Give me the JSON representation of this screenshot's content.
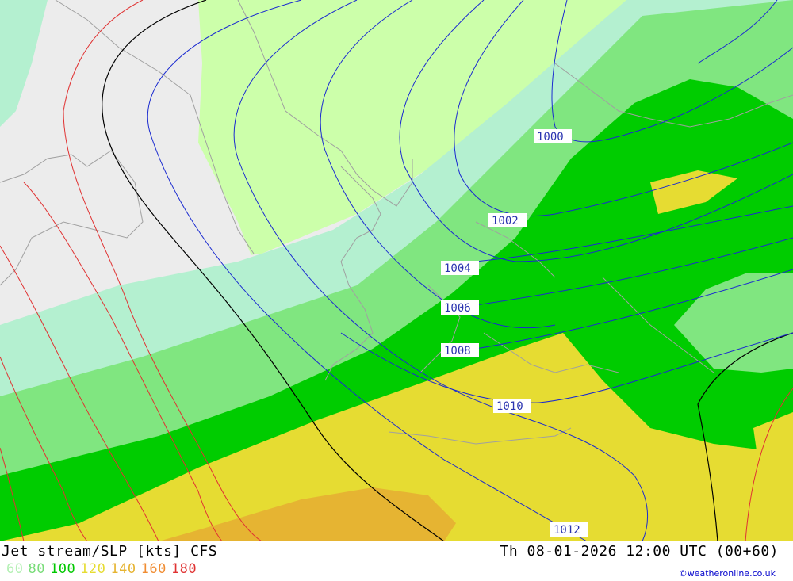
{
  "header": {
    "title_left": "Jet stream/SLP [kts] CFS",
    "title_right": "Th 08-01-2026 12:00 UTC (00+60)"
  },
  "legend": [
    {
      "label": "60",
      "color": "#b4f0b4"
    },
    {
      "label": "80",
      "color": "#78dc78"
    },
    {
      "label": "100",
      "color": "#00c800"
    },
    {
      "label": "120",
      "color": "#e6dc32"
    },
    {
      "label": "140",
      "color": "#e6b432"
    },
    {
      "label": "160",
      "color": "#f08c32"
    },
    {
      "label": "180",
      "color": "#e03232"
    }
  ],
  "credit": "©weatheronline.co.uk",
  "isobars": [
    {
      "label": "1000"
    },
    {
      "label": "1002"
    },
    {
      "label": "1004"
    },
    {
      "label": "1006"
    },
    {
      "label": "1008"
    },
    {
      "label": "1010"
    },
    {
      "label": "1012"
    }
  ],
  "colors": {
    "land_gray": "#ececec",
    "lowland_green": "#ccffaa",
    "band_60": "#b4f0d0",
    "band_80": "#80e680",
    "band_100": "#00cc00",
    "band_120": "#e6dc32",
    "band_140": "#e6b432",
    "isobar": "#1a2ad0"
  }
}
